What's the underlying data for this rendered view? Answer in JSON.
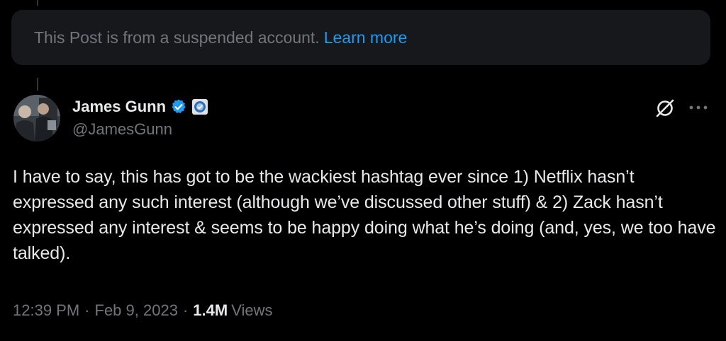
{
  "suspended_notice": {
    "text": "This Post is from a suspended account.",
    "link": "Learn more"
  },
  "author": {
    "display_name": "James Gunn",
    "handle": "@JamesGunn",
    "verified_icon": "verified-badge-icon",
    "affiliate_icon": "affiliate-badge-icon"
  },
  "post": {
    "text": "I have to say, this has got to be the wackiest hashtag ever since 1) Netflix hasn’t expressed any such interest (although we’ve discussed other stuff) & 2) Zack hasn’t expressed any interest & seems to be happy doing what he’s doing (and, yes, we too have talked).",
    "time": "12:39 PM",
    "date": "Feb 9, 2023",
    "views_count": "1.4M",
    "views_label": "Views",
    "separator": "·"
  },
  "actions": {
    "grok_icon": "grok-icon",
    "more_icon": "more-options-icon"
  },
  "colors": {
    "background": "#000000",
    "notice_background": "#16181c",
    "link": "#1d9bf0",
    "secondary_text": "#71767b",
    "primary_text": "#e7e9ea"
  }
}
